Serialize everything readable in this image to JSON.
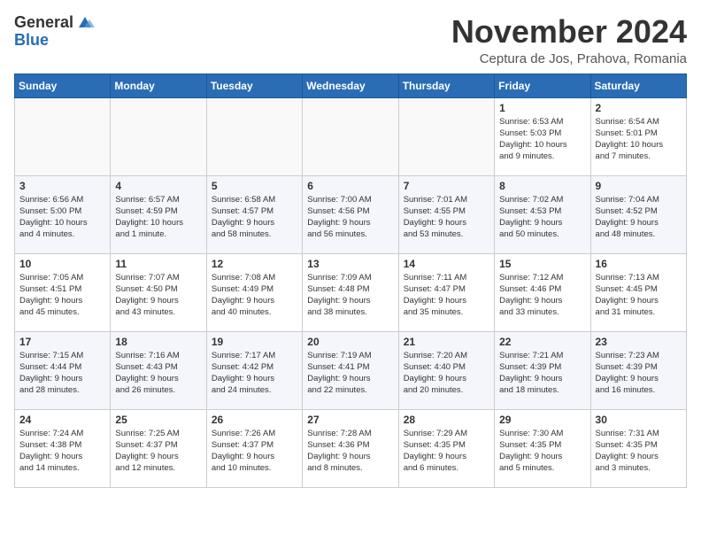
{
  "header": {
    "logo_general": "General",
    "logo_blue": "Blue",
    "month_title": "November 2024",
    "location": "Ceptura de Jos, Prahova, Romania"
  },
  "weekdays": [
    "Sunday",
    "Monday",
    "Tuesday",
    "Wednesday",
    "Thursday",
    "Friday",
    "Saturday"
  ],
  "weeks": [
    [
      {
        "day": "",
        "info": ""
      },
      {
        "day": "",
        "info": ""
      },
      {
        "day": "",
        "info": ""
      },
      {
        "day": "",
        "info": ""
      },
      {
        "day": "",
        "info": ""
      },
      {
        "day": "1",
        "info": "Sunrise: 6:53 AM\nSunset: 5:03 PM\nDaylight: 10 hours\nand 9 minutes."
      },
      {
        "day": "2",
        "info": "Sunrise: 6:54 AM\nSunset: 5:01 PM\nDaylight: 10 hours\nand 7 minutes."
      }
    ],
    [
      {
        "day": "3",
        "info": "Sunrise: 6:56 AM\nSunset: 5:00 PM\nDaylight: 10 hours\nand 4 minutes."
      },
      {
        "day": "4",
        "info": "Sunrise: 6:57 AM\nSunset: 4:59 PM\nDaylight: 10 hours\nand 1 minute."
      },
      {
        "day": "5",
        "info": "Sunrise: 6:58 AM\nSunset: 4:57 PM\nDaylight: 9 hours\nand 58 minutes."
      },
      {
        "day": "6",
        "info": "Sunrise: 7:00 AM\nSunset: 4:56 PM\nDaylight: 9 hours\nand 56 minutes."
      },
      {
        "day": "7",
        "info": "Sunrise: 7:01 AM\nSunset: 4:55 PM\nDaylight: 9 hours\nand 53 minutes."
      },
      {
        "day": "8",
        "info": "Sunrise: 7:02 AM\nSunset: 4:53 PM\nDaylight: 9 hours\nand 50 minutes."
      },
      {
        "day": "9",
        "info": "Sunrise: 7:04 AM\nSunset: 4:52 PM\nDaylight: 9 hours\nand 48 minutes."
      }
    ],
    [
      {
        "day": "10",
        "info": "Sunrise: 7:05 AM\nSunset: 4:51 PM\nDaylight: 9 hours\nand 45 minutes."
      },
      {
        "day": "11",
        "info": "Sunrise: 7:07 AM\nSunset: 4:50 PM\nDaylight: 9 hours\nand 43 minutes."
      },
      {
        "day": "12",
        "info": "Sunrise: 7:08 AM\nSunset: 4:49 PM\nDaylight: 9 hours\nand 40 minutes."
      },
      {
        "day": "13",
        "info": "Sunrise: 7:09 AM\nSunset: 4:48 PM\nDaylight: 9 hours\nand 38 minutes."
      },
      {
        "day": "14",
        "info": "Sunrise: 7:11 AM\nSunset: 4:47 PM\nDaylight: 9 hours\nand 35 minutes."
      },
      {
        "day": "15",
        "info": "Sunrise: 7:12 AM\nSunset: 4:46 PM\nDaylight: 9 hours\nand 33 minutes."
      },
      {
        "day": "16",
        "info": "Sunrise: 7:13 AM\nSunset: 4:45 PM\nDaylight: 9 hours\nand 31 minutes."
      }
    ],
    [
      {
        "day": "17",
        "info": "Sunrise: 7:15 AM\nSunset: 4:44 PM\nDaylight: 9 hours\nand 28 minutes."
      },
      {
        "day": "18",
        "info": "Sunrise: 7:16 AM\nSunset: 4:43 PM\nDaylight: 9 hours\nand 26 minutes."
      },
      {
        "day": "19",
        "info": "Sunrise: 7:17 AM\nSunset: 4:42 PM\nDaylight: 9 hours\nand 24 minutes."
      },
      {
        "day": "20",
        "info": "Sunrise: 7:19 AM\nSunset: 4:41 PM\nDaylight: 9 hours\nand 22 minutes."
      },
      {
        "day": "21",
        "info": "Sunrise: 7:20 AM\nSunset: 4:40 PM\nDaylight: 9 hours\nand 20 minutes."
      },
      {
        "day": "22",
        "info": "Sunrise: 7:21 AM\nSunset: 4:39 PM\nDaylight: 9 hours\nand 18 minutes."
      },
      {
        "day": "23",
        "info": "Sunrise: 7:23 AM\nSunset: 4:39 PM\nDaylight: 9 hours\nand 16 minutes."
      }
    ],
    [
      {
        "day": "24",
        "info": "Sunrise: 7:24 AM\nSunset: 4:38 PM\nDaylight: 9 hours\nand 14 minutes."
      },
      {
        "day": "25",
        "info": "Sunrise: 7:25 AM\nSunset: 4:37 PM\nDaylight: 9 hours\nand 12 minutes."
      },
      {
        "day": "26",
        "info": "Sunrise: 7:26 AM\nSunset: 4:37 PM\nDaylight: 9 hours\nand 10 minutes."
      },
      {
        "day": "27",
        "info": "Sunrise: 7:28 AM\nSunset: 4:36 PM\nDaylight: 9 hours\nand 8 minutes."
      },
      {
        "day": "28",
        "info": "Sunrise: 7:29 AM\nSunset: 4:35 PM\nDaylight: 9 hours\nand 6 minutes."
      },
      {
        "day": "29",
        "info": "Sunrise: 7:30 AM\nSunset: 4:35 PM\nDaylight: 9 hours\nand 5 minutes."
      },
      {
        "day": "30",
        "info": "Sunrise: 7:31 AM\nSunset: 4:35 PM\nDaylight: 9 hours\nand 3 minutes."
      }
    ]
  ]
}
